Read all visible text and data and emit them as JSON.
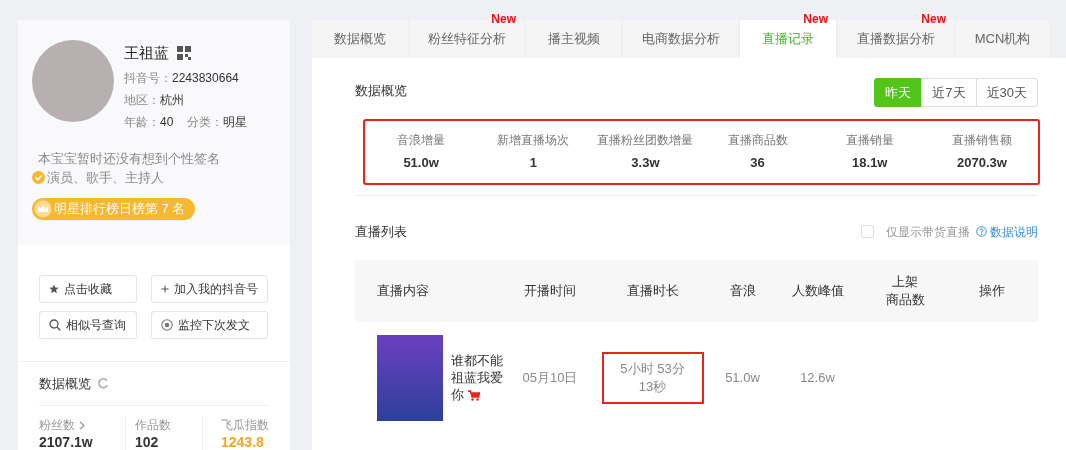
{
  "profile": {
    "name": "王祖蓝",
    "douyin_id_label": "抖音号：",
    "douyin_id": "2243830664",
    "region_label": "地区：",
    "region": "杭州",
    "age_label": "年龄：",
    "age": "40",
    "category_label": "分类：",
    "category": "明星",
    "signature": "本宝宝暂时还没有想到个性签名",
    "verified_tags": "演员、歌手、主持人",
    "rank_badge": "明星排行榜日榜第 7 名"
  },
  "actions": [
    {
      "kind": "star",
      "label": "点击收藏"
    },
    {
      "kind": "plus",
      "label": "加入我的抖音号"
    },
    {
      "kind": "search",
      "label": "相似号查询"
    },
    {
      "kind": "eye",
      "label": "监控下次发文"
    }
  ],
  "side_overview": {
    "title": "数据概览",
    "stats": [
      {
        "kind": "link",
        "label": "粉丝数",
        "value": "2107.1w"
      },
      {
        "kind": "plain",
        "label": "作品数",
        "value": "102"
      },
      {
        "kind": "score",
        "label": "飞瓜指数",
        "value": "1243.8"
      }
    ]
  },
  "tabs": [
    {
      "label": "数据概览",
      "selected": false
    },
    {
      "label": "粉丝特征分析",
      "selected": false,
      "badge": "New"
    },
    {
      "label": "播主视频",
      "selected": false
    },
    {
      "label": "电商数据分析",
      "selected": false
    },
    {
      "label": "直播记录",
      "selected": true,
      "badge": "New"
    },
    {
      "label": "直播数据分析",
      "selected": false,
      "badge": "New"
    },
    {
      "label": "MCN机构",
      "selected": false
    }
  ],
  "overview": {
    "title": "数据概览",
    "ranges": [
      {
        "label": "昨天",
        "selected": true
      },
      {
        "label": "近7天",
        "selected": false
      },
      {
        "label": "近30天",
        "selected": false
      }
    ],
    "highlighted": true,
    "metrics": [
      {
        "label": "音浪增量",
        "value": "51.0w"
      },
      {
        "label": "新增直播场次",
        "value": "1"
      },
      {
        "label": "直播粉丝团数增量",
        "value": "3.3w"
      },
      {
        "label": "直播商品数",
        "value": "36"
      },
      {
        "label": "直播销量",
        "value": "18.1w"
      },
      {
        "label": "直播销售额",
        "value": "2070.3w"
      }
    ]
  },
  "live_list": {
    "title": "直播列表",
    "filter": {
      "label": "仅显示带货直播",
      "checked": false
    },
    "help_link": "数据说明",
    "columns": [
      [
        "直播内容"
      ],
      [
        "开播时间"
      ],
      [
        "直播时长"
      ],
      [
        "音浪"
      ],
      [
        "人数峰值"
      ],
      [
        "上架",
        "商品数"
      ],
      [
        "操作"
      ]
    ],
    "rows": [
      {
        "title": "谁都不能祖蓝我爱你",
        "has_goods": true,
        "start": "05月10日",
        "duration": "5小时 53分\n13秒",
        "duration_highlighted": true,
        "sound_waves": "51.0w",
        "peak": "12.6w"
      }
    ]
  }
}
